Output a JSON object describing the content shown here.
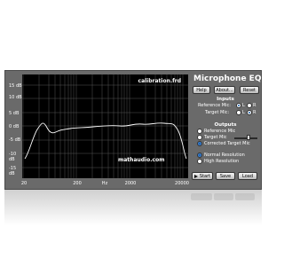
{
  "app": {
    "title": "Microphone EQ",
    "calibration_file": "calibration.frd",
    "site": "mathaudio.com"
  },
  "toolbar": {
    "help_label": "Help",
    "about_label": "About...",
    "reset_label": "Reset"
  },
  "inputs": {
    "section_title": "Inputs",
    "reference_mic_label": "Reference Mic:",
    "target_mic_label": "Target Mic:",
    "left_label": "L",
    "right_label": "R",
    "reference_selected": "L",
    "target_selected": "R"
  },
  "outputs": {
    "section_title": "Outputs",
    "items": [
      {
        "label": "Reference Mic"
      },
      {
        "label": "Target Mic"
      },
      {
        "label": "Corrected Target Mic"
      }
    ],
    "selected": "Corrected Target Mic",
    "volume_level": 0.6
  },
  "resolution": {
    "items": [
      {
        "label": "Normal Resolution"
      },
      {
        "label": "High Resolution"
      }
    ],
    "selected": "Normal Resolution"
  },
  "actions": {
    "start_label": "Start",
    "save_label": "Save",
    "load_label": "Load"
  },
  "graph": {
    "y_ticks": [
      "15 dB",
      "10 dB",
      "5 dB",
      "0 dB",
      "-5 dB",
      "-10 dB",
      "-15 dB"
    ],
    "x_ticks": [
      "20",
      "200",
      "Hz",
      "2000",
      "20000"
    ],
    "curve_color": "#ffffff",
    "background_color": "#000000",
    "grid_color": "#555555"
  },
  "colors": {
    "panel": "#6a6a6a",
    "radio_accent": "#3b7fd0"
  }
}
